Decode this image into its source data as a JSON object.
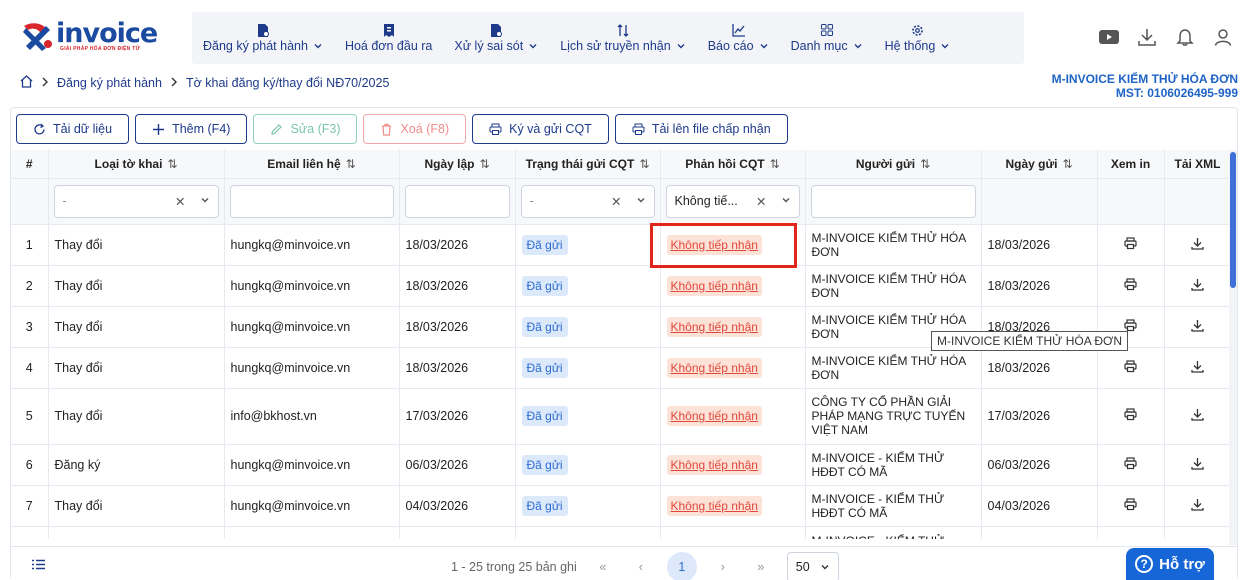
{
  "brand": {
    "name": "invoice",
    "tagline": "GIẢI PHÁP HÓA ĐƠN ĐIỆN TỬ"
  },
  "nav": [
    {
      "label": "Đăng ký phát hành",
      "icon": "document-icon",
      "dropdown": true
    },
    {
      "label": "Hoá đơn đầu ra",
      "icon": "invoice-icon",
      "dropdown": false
    },
    {
      "label": "Xử lý sai sót",
      "icon": "document-icon",
      "dropdown": true
    },
    {
      "label": "Lịch sử truyền nhận",
      "icon": "sort-arrows-icon",
      "dropdown": true
    },
    {
      "label": "Báo cáo",
      "icon": "chart-icon",
      "dropdown": true
    },
    {
      "label": "Danh mục",
      "icon": "grid-icon",
      "dropdown": true
    },
    {
      "label": "Hệ thống",
      "icon": "gear-icon",
      "dropdown": true
    }
  ],
  "top_icons": [
    "youtube-icon",
    "download-icon",
    "bell-icon",
    "user-icon"
  ],
  "breadcrumb": {
    "level1": "Đăng ký phát hành",
    "level2": "Tờ khai đăng ký/thay đổi NĐ70/2025"
  },
  "company": {
    "name": "M-INVOICE KIỂM THỬ HÓA ĐƠN",
    "tax": "MST: 0106026495-999"
  },
  "toolbar": {
    "reload": "Tải dữ liệu",
    "add": "Thêm (F4)",
    "edit": "Sửa (F3)",
    "delete": "Xoá (F8)",
    "sign_send": "Ký và gửi CQT",
    "upload": "Tải lên file chấp nhận"
  },
  "columns": {
    "num": "#",
    "type": "Loại tờ khai",
    "email": "Email liên hệ",
    "date": "Ngày lập",
    "status": "Trạng thái gửi CQT",
    "response": "Phản hồi CQT",
    "sender": "Người gửi",
    "sent_date": "Ngày gửi",
    "view": "Xem in",
    "xml": "Tải XML"
  },
  "filters": {
    "type": "-",
    "status": "-",
    "response": "Không tiế..."
  },
  "rows": [
    {
      "num": "1",
      "type": "Thay đổi",
      "email": "hungkq@minvoice.vn",
      "date": "18/03/2026",
      "status": "Đã gửi",
      "response": "Không tiếp nhận",
      "sender": "M-INVOICE KIỂM THỬ HÓA ĐƠN",
      "sent_date": "18/03/2026"
    },
    {
      "num": "2",
      "type": "Thay đổi",
      "email": "hungkq@minvoice.vn",
      "date": "18/03/2026",
      "status": "Đã gửi",
      "response": "Không tiếp nhận",
      "sender": "M-INVOICE KIỂM THỬ HÓA ĐƠN",
      "sent_date": "18/03/2026"
    },
    {
      "num": "3",
      "type": "Thay đổi",
      "email": "hungkq@minvoice.vn",
      "date": "18/03/2026",
      "status": "Đã gửi",
      "response": "Không tiếp nhận",
      "sender": "M-INVOICE KIỂM THỬ HÓA ĐƠN",
      "sent_date": "18/03/2026"
    },
    {
      "num": "4",
      "type": "Thay đổi",
      "email": "hungkq@minvoice.vn",
      "date": "18/03/2026",
      "status": "Đã gửi",
      "response": "Không tiếp nhận",
      "sender": "M-INVOICE KIỂM THỬ HÓA ĐƠN",
      "sent_date": "18/03/2026"
    },
    {
      "num": "5",
      "type": "Thay đổi",
      "email": "info@bkhost.vn",
      "date": "17/03/2026",
      "status": "Đã gửi",
      "response": "Không tiếp nhận",
      "sender": "CÔNG TY CỔ PHẦN GIẢI PHÁP MẠNG TRỰC TUYẾN VIỆT NAM",
      "sent_date": "17/03/2026"
    },
    {
      "num": "6",
      "type": "Đăng ký",
      "email": "hungkq@minvoice.vn",
      "date": "06/03/2026",
      "status": "Đã gửi",
      "response": "Không tiếp nhận",
      "sender": "M-INVOICE - KIỂM THỬ HĐĐT CÓ MÃ",
      "sent_date": "06/03/2026"
    },
    {
      "num": "7",
      "type": "Thay đổi",
      "email": "hungkq@minvoice.vn",
      "date": "04/03/2026",
      "status": "Đã gửi",
      "response": "Không tiếp nhận",
      "sender": "M-INVOICE - KIỂM THỬ HĐĐT CÓ MÃ",
      "sent_date": "04/03/2026"
    },
    {
      "num": "",
      "type": "",
      "email": "",
      "date": "",
      "status": "",
      "response": "",
      "sender": "M-INVOICE - KIỂM THỬ",
      "sent_date": ""
    }
  ],
  "tooltip": "M-INVOICE KIỂM THỬ HÓA ĐƠN",
  "pager": {
    "summary": "1 - 25 trong 25 bản ghi",
    "current": "1",
    "page_size": "50"
  },
  "help": "Hỗ trợ",
  "colors": {
    "primary": "#1e3a8a",
    "accent": "#1666d8",
    "danger": "#e1251b",
    "sent_badge": "#dbe9fb",
    "reject_badge": "#fde2d8"
  }
}
